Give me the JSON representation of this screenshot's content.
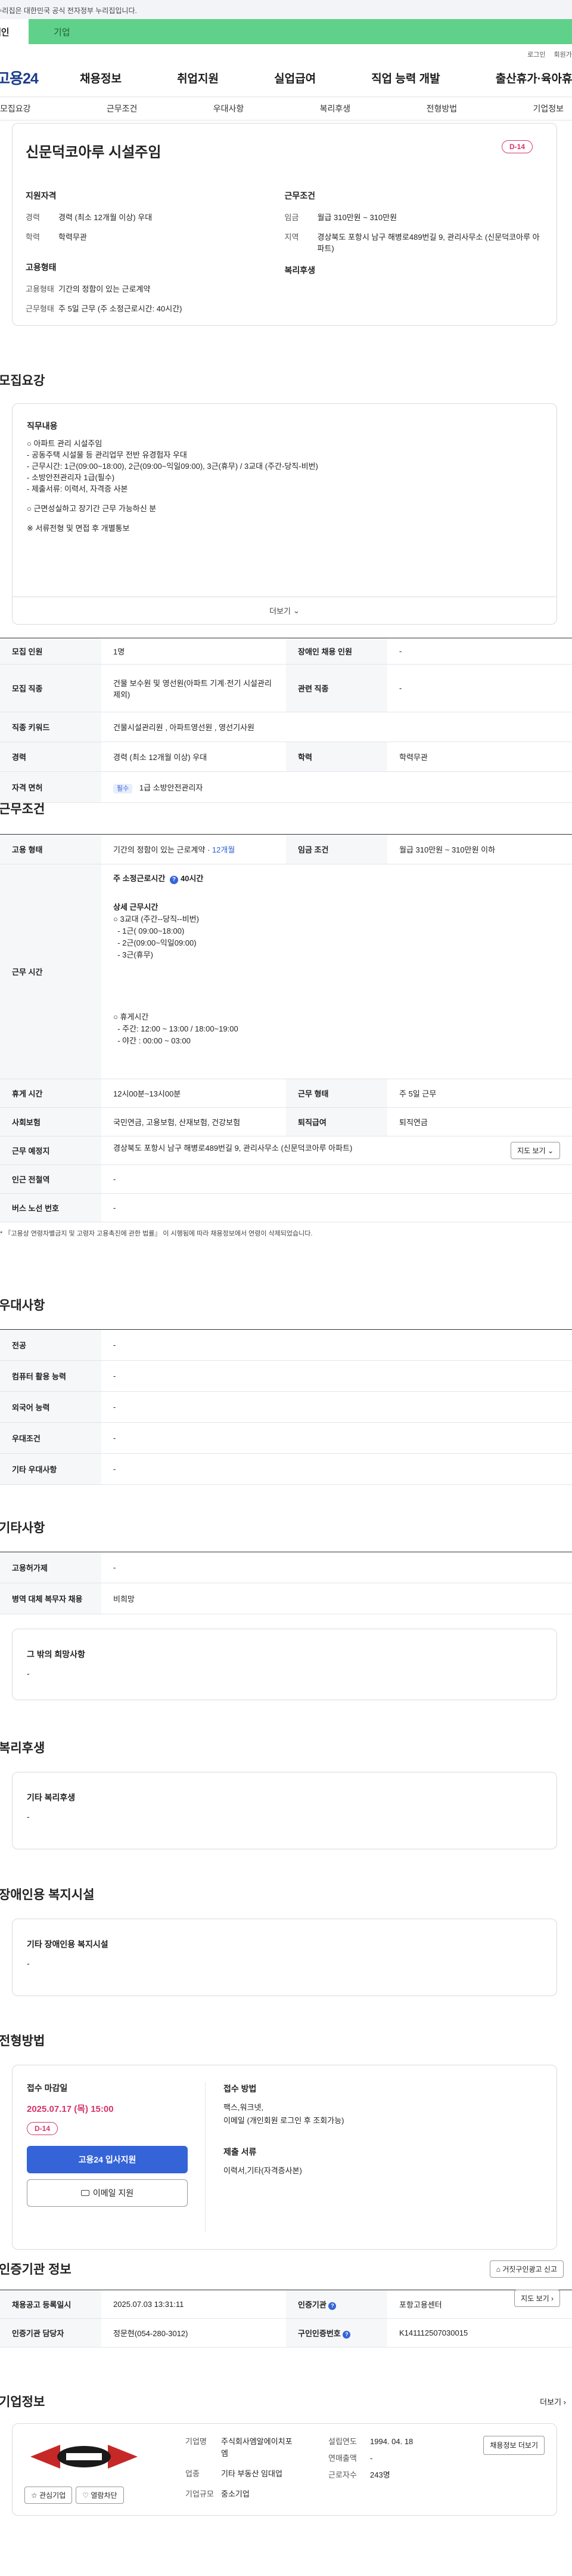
{
  "banner": {
    "text": "이 누리집은 대한민국 공식 전자정부 누리집입니다."
  },
  "segment": {
    "personal": "개인",
    "company": "기업"
  },
  "util": {
    "login": "로그인",
    "signup": "회원가입"
  },
  "gnb": {
    "logo": "고용24",
    "menu": [
      "채용정보",
      "취업지원",
      "실업급여",
      "직업 능력 개발",
      "출산휴가·육아휴직"
    ]
  },
  "subtabs": [
    "모집요강",
    "근무조건",
    "우대사항",
    "복리후생",
    "전형방법",
    "기업정보"
  ],
  "summary": {
    "title": "신문덕코아루 시설주임",
    "dday": "D-14",
    "qual_title": "지원자격",
    "career_k": "경력",
    "career_v": "경력 (최소 12개월 이상) 우대",
    "edu_k": "학력",
    "edu_v": "학력무관",
    "emp_title": "고용형태",
    "emptype_k": "고용형태",
    "emptype_v": "기간의 정함이 있는 근로계약",
    "workform_k": "근무형태",
    "workform_v": "주 5일 근무 (주 소정근로시간: 40시간)",
    "cond_title": "근무조건",
    "wage_k": "임금",
    "wage_v": "월급 310만원 ~ 310만원",
    "region_k": "지역",
    "region_v": "경상북도 포항시 남구 해병로489번길 9, 관리사무소 (신문덕코아루 아파트)",
    "welfare_title": "복리후생"
  },
  "recruit": {
    "heading": "모집요강",
    "desc_title": "직무내용",
    "desc_lines": [
      "○ 아파트 관리 시설주임",
      " - 공동주택 시설물 등 관리업무 전반 유경험자 우대",
      " - 근무시간: 1근(09:00~18:00), 2근(09:00~익일09:00), 3근(휴무) / 3교대 (주간-당직-비번)",
      " - 소방안전관리자 1급(필수)",
      " - 제출서류: 이력서, 자격증 사본",
      "",
      "○ 근면성실하고 장기간 근무 가능하신 분",
      "",
      "※ 서류전형 및 면접 후 개별통보"
    ],
    "more": "더보기",
    "rows": {
      "count_k": "모집 인원",
      "count_v": "1명",
      "disabled_k": "장애인 채용 인원",
      "disabled_v": "-",
      "job_k": "모집 직종",
      "job_v": "건물 보수원 및 영선원(아파트 기계·전기 시설관리 제외)",
      "related_k": "관련 직종",
      "related_v": "-",
      "keyword_k": "직종 키워드",
      "keyword_v": "건물시설관리원 , 아파트영선원 , 영선기사원",
      "career_k": "경력",
      "career_v": "경력 (최소 12개월 이상) 우대",
      "edu_k": "학력",
      "edu_v": "학력무관",
      "license_k": "자격 면허",
      "license_tag": "필수",
      "license_v": "1급 소방안전관리자"
    }
  },
  "conditions": {
    "heading": "근무조건",
    "emptype_k": "고용 형태",
    "emptype_v": "기간의 정함이 있는 근로계약 · ",
    "emptype_period": "12개월",
    "wage_k": "임금 조건",
    "wage_v": "월급 310만원 ~ 310만원 이하",
    "hours_k": "근무 시간",
    "hours_total": "주 소정근로시간 ",
    "hours_total_v": "40시간",
    "hours_detail_title": "상세 근무시간",
    "hours_lines": [
      "○ 3교대 (주간--당직--비번)",
      "  - 1근( 09:00~18:00)",
      "  - 2근(09:00~익일09:00)",
      "  - 3근(휴무)"
    ],
    "break_title": "○ 휴게시간",
    "break_lines": [
      "  - 주간: 12:00 ~ 13:00 / 18:00~19:00",
      "  - 야간 : 00:00 ~ 03:00"
    ],
    "break_k": "휴게 시간",
    "break_v": "12시00분~13시00분",
    "form_k": "근무 형태",
    "form_v": "주 5일 근무",
    "insurance_k": "사회보험",
    "insurance_v": "국민연금, 고용보험, 산재보험, 건강보험",
    "retire_k": "퇴직급여",
    "retire_v": "퇴직연금",
    "location_k": "근무 예정지",
    "location_v": "경상북도 포항시 남구 해병로489번길 9, 관리사무소 (신문덕코아루 아파트)",
    "map_btn": "지도 보기",
    "station_k": "인근 전철역",
    "station_v": "-",
    "bus_k": "버스 노선 번호",
    "bus_v": "-",
    "note": "* 『고용상 연령차별금지 및 고령자 고용촉진에 관한 법률』 이 시행됨에 따라 채용정보에서 연령이 삭제되었습니다."
  },
  "preference": {
    "heading": "우대사항",
    "rows": [
      {
        "k": "전공",
        "v": "-"
      },
      {
        "k": "컴퓨터 활용 능력",
        "v": "-"
      },
      {
        "k": "외국어 능력",
        "v": "-"
      },
      {
        "k": "우대조건",
        "v": "-"
      },
      {
        "k": "기타 우대사항",
        "v": "-"
      }
    ]
  },
  "others": {
    "heading": "기타사항",
    "rows": [
      {
        "k": "고용허가제",
        "v": "-"
      },
      {
        "k": "병역 대체 복무자 채용",
        "v": "비희망"
      }
    ],
    "hope_title": "그 밖의 희망사항",
    "hope_v": "-"
  },
  "welfare": {
    "heading": "복리후생",
    "card_title": "기타 복리후생",
    "card_v": "-"
  },
  "disabled_facility": {
    "heading": "장애인용 복지시설",
    "card_title": "기타 장애인용 복지시설",
    "card_v": "-"
  },
  "apply": {
    "heading": "전형방법",
    "deadline_k": "접수 마감일",
    "deadline_v": "2025.07.17 (목) 15:00",
    "dday": "D-14",
    "apply_btn": "고용24 입사지원",
    "email_btn": "이메일 지원",
    "method_k": "접수 방법",
    "method_v1": "팩스,워크넷,",
    "method_v2": "이메일 (개인회원 로그인 후 조회가능)",
    "docs_k": "제출 서류",
    "docs_v": "이력서,기타(자격증사본)"
  },
  "agency": {
    "heading": "인증기관 정보",
    "report_btn": "거짓구인광고 신고",
    "reg_k": "채용공고 등록일시",
    "reg_v": "2025.07.03 13:31:11",
    "agency_k": "인증기관",
    "agency_v": "포항고용센터",
    "map_btn": "지도 보기",
    "staff_k": "인증기관 담당자",
    "staff_v": "정문현(054-280-3012)",
    "id_k": "구인인증번호",
    "id_v": "K141112507030015"
  },
  "company": {
    "heading": "기업정보",
    "more": "더보기",
    "name_k": "기업명",
    "name_v": "주식회사엠알에이치포엠",
    "est_k": "설립연도",
    "est_v": "1994. 04. 18",
    "sales_k": "연매출액",
    "sales_v": "-",
    "industry_k": "업종",
    "industry_v": "기타 부동산 임대업",
    "staff_k": "근로자수",
    "staff_v": "243명",
    "size_k": "기업규모",
    "size_v": "중소기업",
    "interest_btn": "관심기업",
    "block_btn": "열람차단",
    "jobs_btn": "채용정보 더보기"
  },
  "colors": {
    "brand": "#1c3d8c",
    "company_tab": "#5fd18a",
    "dday": "#d6336c",
    "primary": "#3564d8"
  }
}
